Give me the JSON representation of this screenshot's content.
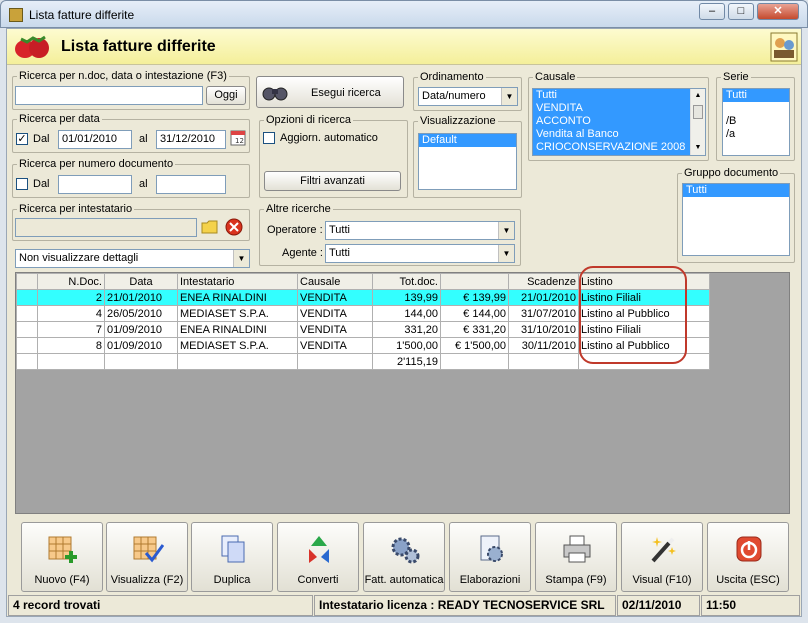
{
  "window": {
    "title": "Lista fatture differite"
  },
  "header": {
    "title": "Lista fatture differite"
  },
  "search": {
    "legend": "Ricerca per n.doc, data o intestazione (F3)",
    "value": "",
    "oggi": "Oggi",
    "esegui": "Esegui ricerca"
  },
  "data_search": {
    "legend": "Ricerca per data",
    "dal_checked": true,
    "dal": "Dal",
    "from": "01/01/2010",
    "al": "al",
    "to": "31/12/2010"
  },
  "num_search": {
    "legend": "Ricerca per numero documento",
    "dal": "Dal",
    "from": "",
    "al": "al",
    "to": ""
  },
  "intest": {
    "legend": "Ricerca per intestatario",
    "value": ""
  },
  "details_select": "Non visualizzare dettagli",
  "options": {
    "legend": "Opzioni di ricerca",
    "aggiorn": "Aggiorn. automatico",
    "filtri": "Filtri avanzati"
  },
  "ordinamento": {
    "legend": "Ordinamento",
    "value": "Data/numero"
  },
  "visualizzazione": {
    "legend": "Visualizzazione",
    "items": [
      "Default"
    ]
  },
  "causale": {
    "legend": "Causale",
    "items": [
      "Tutti",
      "VENDITA",
      "ACCONTO",
      "Vendita al Banco",
      "CRIOCONSERVAZIONE 2008"
    ]
  },
  "serie": {
    "legend": "Serie",
    "items": [
      "Tutti",
      "",
      "/B",
      "/a"
    ]
  },
  "gruppo": {
    "legend": "Gruppo documento",
    "items": [
      "Tutti"
    ]
  },
  "altre": {
    "legend": "Altre ricerche",
    "operatore_label": "Operatore :",
    "operatore": "Tutti",
    "agente_label": "Agente :",
    "agente": "Tutti"
  },
  "table": {
    "columns": [
      "N.Doc.",
      "Data",
      "Intestatario",
      "Causale",
      "Tot.doc.",
      "",
      "Scadenze",
      "Listino"
    ],
    "rows": [
      {
        "ndoc": "2",
        "data": "21/01/2010",
        "intest": "ENEA RINALDINI",
        "causale": "VENDITA",
        "tot": "139,99",
        "importo": "€ 139,99",
        "scad": "21/01/2010",
        "listino": "Listino Filiali"
      },
      {
        "ndoc": "4",
        "data": "26/05/2010",
        "intest": "MEDIASET S.P.A.",
        "causale": "VENDITA",
        "tot": "144,00",
        "importo": "€ 144,00",
        "scad": "31/07/2010",
        "listino": "Listino al Pubblico"
      },
      {
        "ndoc": "7",
        "data": "01/09/2010",
        "intest": "ENEA RINALDINI",
        "causale": "VENDITA",
        "tot": "331,20",
        "importo": "€ 331,20",
        "scad": "31/10/2010",
        "listino": "Listino Filiali"
      },
      {
        "ndoc": "8",
        "data": "01/09/2010",
        "intest": "MEDIASET S.P.A.",
        "causale": "VENDITA",
        "tot": "1'500,00",
        "importo": "€ 1'500,00",
        "scad": "30/11/2010",
        "listino": "Listino al Pubblico"
      }
    ],
    "total": "2'115,19"
  },
  "toolbar": [
    {
      "name": "nuovo-button",
      "icon": "new-grid-icon",
      "label": "Nuovo (F4)"
    },
    {
      "name": "visualizza-button",
      "icon": "view-grid-icon",
      "label": "Visualizza (F2)"
    },
    {
      "name": "duplica-button",
      "icon": "duplicate-icon",
      "label": "Duplica"
    },
    {
      "name": "converti-button",
      "icon": "convert-icon",
      "label": "Converti"
    },
    {
      "name": "fatt-automatica-button",
      "icon": "gears-icon",
      "label": "Fatt. automatica"
    },
    {
      "name": "elaborazioni-button",
      "icon": "process-icon",
      "label": "Elaborazioni"
    },
    {
      "name": "stampa-button",
      "icon": "printer-icon",
      "label": "Stampa (F9)"
    },
    {
      "name": "visual-button",
      "icon": "magic-wand-icon",
      "label": "Visual (F10)"
    },
    {
      "name": "uscita-button",
      "icon": "power-icon",
      "label": "Uscita (ESC)"
    }
  ],
  "status": {
    "records": "4 record trovati",
    "licenza": "Intestatario licenza : READY TECNOSERVICE SRL",
    "date": "02/11/2010",
    "time": "11:50"
  },
  "colors": {
    "highlight_row": "#33ffff",
    "selection": "#3399ff",
    "header_bg": "#f4ef9a",
    "annotation": "#c0392b"
  }
}
